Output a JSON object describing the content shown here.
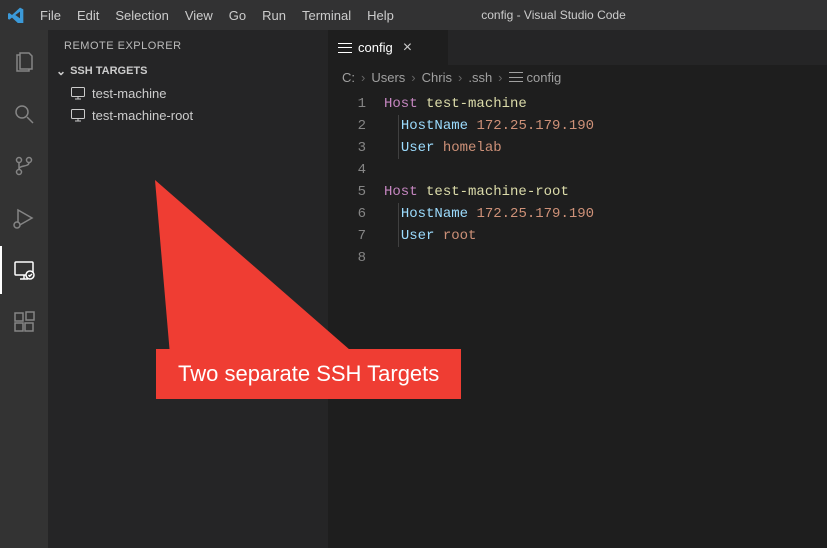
{
  "titlebar": {
    "title": "config - Visual Studio Code",
    "menu": [
      "File",
      "Edit",
      "Selection",
      "View",
      "Go",
      "Run",
      "Terminal",
      "Help"
    ]
  },
  "activity": {
    "items": [
      "files-icon",
      "search-icon",
      "source-control-icon",
      "debug-icon",
      "remote-explorer-icon",
      "extensions-icon"
    ],
    "active_index": 4
  },
  "sidebar": {
    "title": "REMOTE EXPLORER",
    "section": "SSH TARGETS",
    "items": [
      {
        "label": "test-machine"
      },
      {
        "label": "test-machine-root"
      }
    ]
  },
  "tabs": [
    {
      "label": "config",
      "icon": "list-icon"
    }
  ],
  "breadcrumb": [
    "C:",
    "Users",
    "Chris",
    ".ssh",
    "config"
  ],
  "breadcrumb_icon": "list-icon",
  "code": {
    "lines": [
      {
        "n": 1,
        "k": "Host",
        "kc": "k-host",
        "v": "test-machine",
        "vc": "v-host",
        "indent": false
      },
      {
        "n": 2,
        "k": "HostName",
        "kc": "k-key",
        "v": "172.25.179.190",
        "vc": "v-ip",
        "indent": true
      },
      {
        "n": 3,
        "k": "User",
        "kc": "k-key",
        "v": "homelab",
        "vc": "v-user",
        "indent": true
      },
      {
        "n": 4,
        "k": "",
        "kc": "",
        "v": "",
        "vc": "",
        "indent": false
      },
      {
        "n": 5,
        "k": "Host",
        "kc": "k-host",
        "v": "test-machine-root",
        "vc": "v-host",
        "indent": false
      },
      {
        "n": 6,
        "k": "HostName",
        "kc": "k-key",
        "v": "172.25.179.190",
        "vc": "v-ip",
        "indent": true
      },
      {
        "n": 7,
        "k": "User",
        "kc": "k-key",
        "v": "root",
        "vc": "v-user",
        "indent": true
      },
      {
        "n": 8,
        "k": "",
        "kc": "",
        "v": "",
        "vc": "",
        "indent": false
      }
    ]
  },
  "annotation": {
    "label": "Two separate SSH Targets",
    "color": "#ef3d33"
  }
}
